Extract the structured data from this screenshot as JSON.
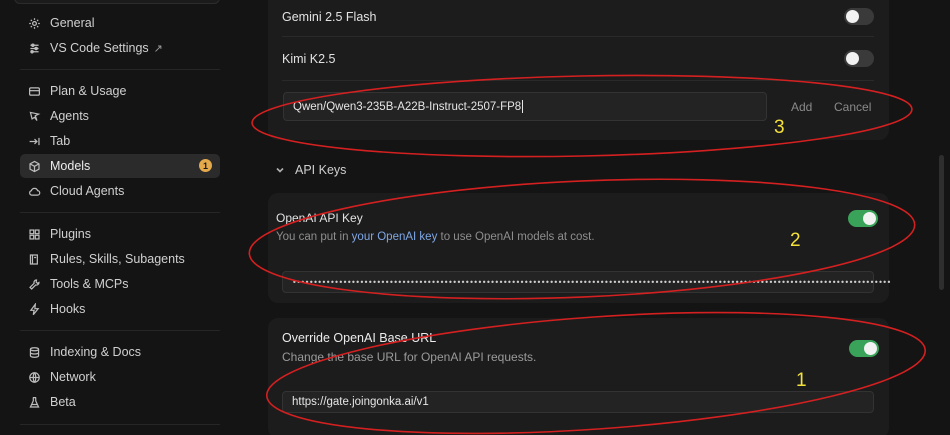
{
  "sidebar": {
    "items": [
      {
        "label": "General",
        "icon": "gear-icon"
      },
      {
        "label": "VS Code Settings",
        "icon": "sliders-icon",
        "external": "↗"
      },
      {
        "label": "Plan & Usage",
        "icon": "credit-card-icon"
      },
      {
        "label": "Agents",
        "icon": "agent-icon"
      },
      {
        "label": "Tab",
        "icon": "tab-arrow-icon"
      },
      {
        "label": "Models",
        "icon": "cube-icon",
        "badge": "1",
        "active": true
      },
      {
        "label": "Cloud Agents",
        "icon": "cloud-icon"
      },
      {
        "label": "Plugins",
        "icon": "grid-icon"
      },
      {
        "label": "Rules, Skills, Subagents",
        "icon": "book-icon"
      },
      {
        "label": "Tools & MCPs",
        "icon": "tools-icon"
      },
      {
        "label": "Hooks",
        "icon": "lightning-icon"
      },
      {
        "label": "Indexing & Docs",
        "icon": "database-icon"
      },
      {
        "label": "Network",
        "icon": "globe-icon"
      },
      {
        "label": "Beta",
        "icon": "flask-icon"
      }
    ]
  },
  "models": {
    "rows": [
      {
        "label": "Gemini 2.5 Flash",
        "enabled": false
      },
      {
        "label": "Kimi K2.5",
        "enabled": false
      }
    ],
    "add_input_value": "Qwen/Qwen3-235B-A22B-Instruct-2507-FP8",
    "add_label": "Add",
    "cancel_label": "Cancel"
  },
  "api_keys": {
    "section_title": "API Keys",
    "openai": {
      "title": "OpenAI API Key",
      "desc_prefix": "You can put in ",
      "desc_link": "your OpenAI key",
      "desc_suffix": " to use OpenAI models at cost.",
      "enabled": true,
      "key_masked": "••••••••••••••••••••••••••••••••••••••••••••••••••••••••••••••••••••••••••••••••••••••••••••••••••••••••••••••••••••••••••••••••••••••••••••••"
    },
    "base_url": {
      "title": "Override OpenAI Base URL",
      "desc": "Change the base URL for OpenAI API requests.",
      "enabled": true,
      "value": "https://gate.joingonka.ai/v1"
    }
  },
  "annotations": {
    "numbers": [
      "1",
      "2",
      "3"
    ],
    "ellipse_color": "#d42020",
    "number_color": "#f5e13a"
  },
  "colors": {
    "toggle_on": "#3aa35a",
    "link": "#7fa7e6",
    "badge": "#e4a94a"
  }
}
